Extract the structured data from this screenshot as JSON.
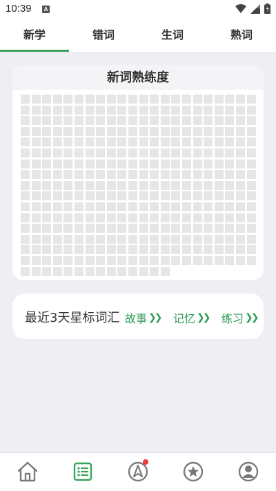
{
  "status_bar": {
    "time": "10:39",
    "notification_letter": "A",
    "icons": [
      "wifi-icon",
      "signal-icon",
      "battery-icon"
    ]
  },
  "tabs": [
    {
      "label": "新学",
      "active": true
    },
    {
      "label": "错词",
      "active": false
    },
    {
      "label": "生词",
      "active": false
    },
    {
      "label": "熟词",
      "active": false
    }
  ],
  "mastery_card": {
    "title": "新词熟练度",
    "grid_columns": 22,
    "grid_total_cells": 366
  },
  "starred_card": {
    "title": "最近3天星标词汇",
    "actions": [
      {
        "label": "故事",
        "icon": "double-chevron-right-icon"
      },
      {
        "label": "记忆",
        "icon": "double-chevron-right-icon"
      },
      {
        "label": "练习",
        "icon": "double-chevron-right-icon"
      }
    ]
  },
  "bottom_nav": {
    "items": [
      {
        "icon": "home-icon",
        "active": false
      },
      {
        "icon": "list-icon",
        "active": true
      },
      {
        "icon": "compass-icon",
        "active": false,
        "badge": true
      },
      {
        "icon": "star-icon",
        "active": false
      },
      {
        "icon": "profile-icon",
        "active": false
      }
    ]
  },
  "colors": {
    "accent": "#3aa35b",
    "action_text": "#2f9a55",
    "background": "#eeeef3",
    "cell": "#e6e6e9",
    "badge": "#f03a3a"
  }
}
